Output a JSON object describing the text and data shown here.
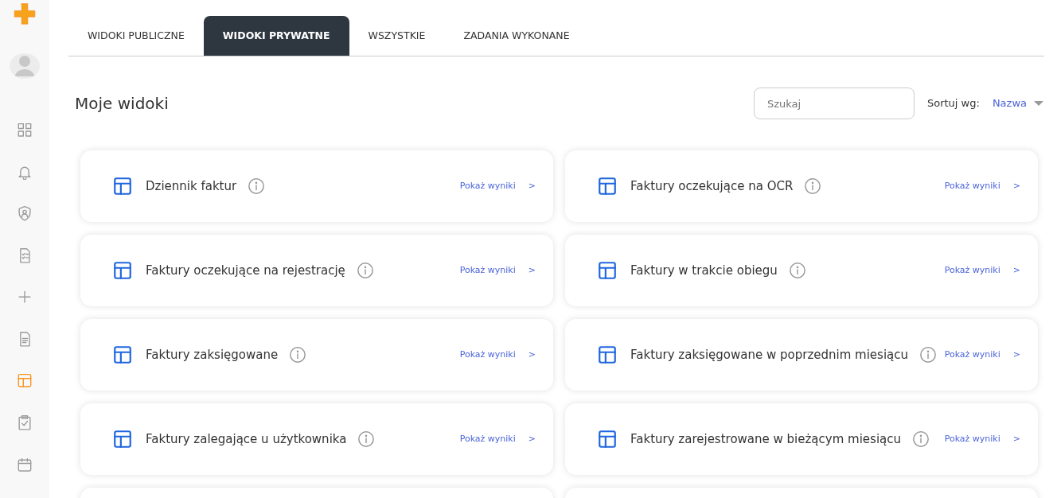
{
  "sidebar": {
    "items": [
      {
        "kind": "grid",
        "selected": false
      },
      {
        "kind": "bell",
        "selected": false
      },
      {
        "kind": "shield",
        "selected": false
      },
      {
        "kind": "checklist",
        "selected": false
      },
      {
        "kind": "plus",
        "selected": false
      },
      {
        "kind": "document",
        "selected": false
      },
      {
        "kind": "layout",
        "selected": true
      },
      {
        "kind": "clipboard",
        "selected": false
      },
      {
        "kind": "calendar",
        "selected": false
      }
    ]
  },
  "tabs": [
    {
      "label": "WIDOKI PUBLICZNE",
      "selected": false
    },
    {
      "label": "WIDOKI PRYWATNE",
      "selected": true
    },
    {
      "label": "WSZYSTKIE",
      "selected": false
    },
    {
      "label": "ZADANIA WYKONANE",
      "selected": false
    }
  ],
  "heading": "Moje widoki",
  "search": {
    "placeholder": "Szukaj"
  },
  "sort": {
    "label": "Sortuj wg:",
    "value": "Nazwa"
  },
  "views": [
    {
      "title": "Dziennik faktur",
      "link": "Pokaż wyniki",
      "arrow": ">"
    },
    {
      "title": "Faktury oczekujące na OCR",
      "link": "Pokaż wyniki",
      "arrow": ">"
    },
    {
      "title": "Faktury oczekujące na rejestrację",
      "link": "Pokaż wyniki",
      "arrow": ">"
    },
    {
      "title": "Faktury w trakcie obiegu",
      "link": "Pokaż wyniki",
      "arrow": ">"
    },
    {
      "title": "Faktury zaksięgowane",
      "link": "Pokaż wyniki",
      "arrow": ">"
    },
    {
      "title": "Faktury zaksięgowane w poprzednim miesiącu",
      "link": "Pokaż wyniki",
      "arrow": ">"
    },
    {
      "title": "Faktury zalegające u użytkownika",
      "link": "Pokaż wyniki",
      "arrow": ">"
    },
    {
      "title": "Faktury zarejestrowane w bieżącym miesiącu",
      "link": "Pokaż wyniki",
      "arrow": ">"
    }
  ]
}
